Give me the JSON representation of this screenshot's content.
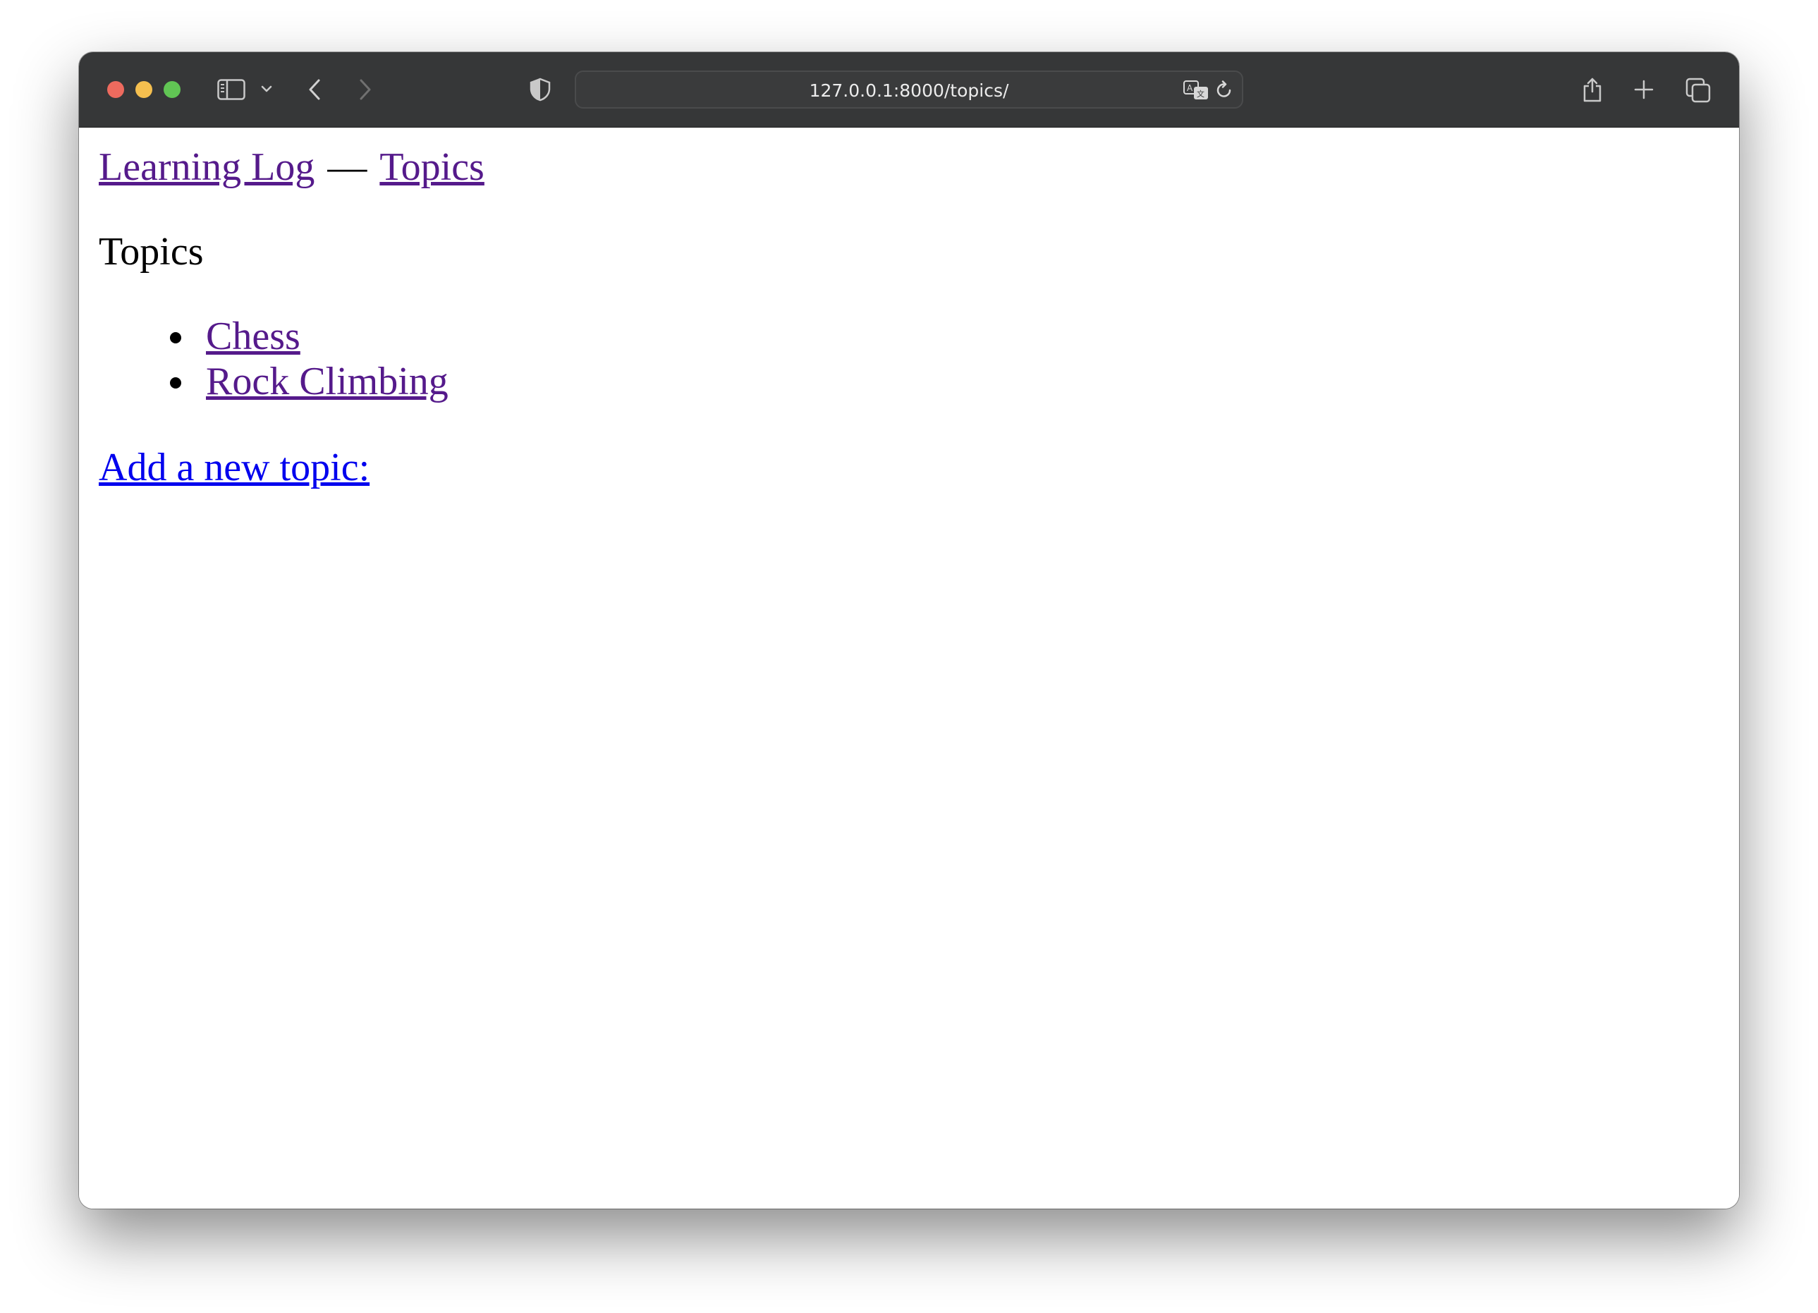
{
  "browser": {
    "url": "127.0.0.1:8000/topics/",
    "icons": {
      "sidebar": "sidebar-icon",
      "chevron": "chevron-down-icon",
      "back": "back-arrow-icon",
      "forward": "forward-arrow-icon",
      "privacy": "shield-icon",
      "translate": "translate-icon",
      "reload": "reload-icon",
      "share": "share-icon",
      "new_tab": "plus-icon",
      "tabs": "tabs-overview-icon"
    }
  },
  "page": {
    "nav": {
      "home_label": "Learning Log",
      "separator": "—",
      "topics_label": "Topics"
    },
    "heading": "Topics",
    "topics": [
      {
        "label": "Chess"
      },
      {
        "label": "Rock Climbing"
      }
    ],
    "add_link": "Add a new topic:"
  },
  "colors": {
    "toolbar": "#363738",
    "visited_link": "#551a8b",
    "unvisited_link": "#0000ee"
  }
}
